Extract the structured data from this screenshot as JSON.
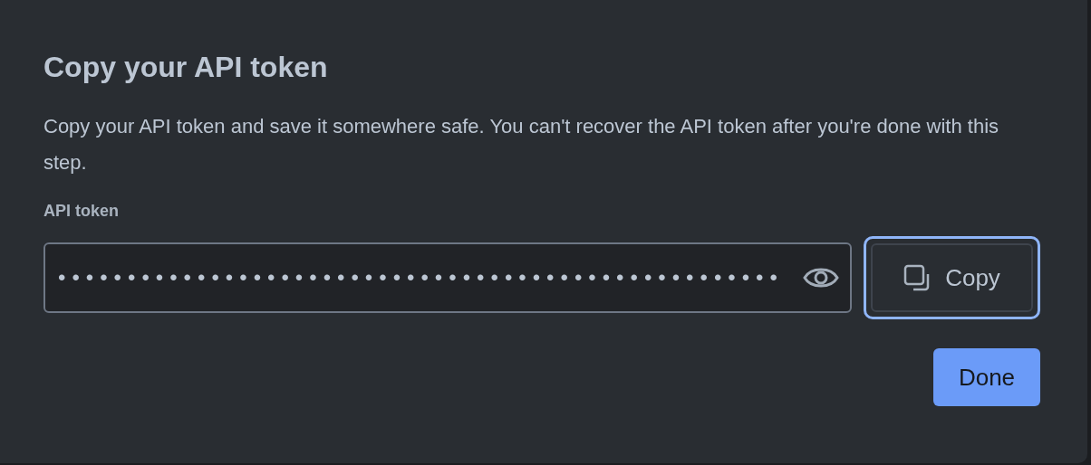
{
  "dialog": {
    "title": "Copy your API token",
    "description": "Copy your API token and save it somewhere safe. You can't recover the API token after you're done with this step.",
    "token_field": {
      "label": "API token",
      "value": "••••••••••••••••••••••••••••••••••••••••••••••••••••"
    },
    "copy_button": {
      "label": "Copy",
      "focused": true
    },
    "done_button": {
      "label": "Done"
    }
  }
}
